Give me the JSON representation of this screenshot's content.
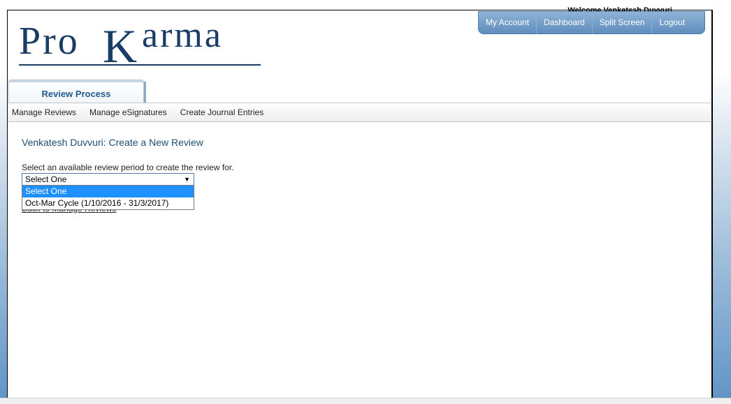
{
  "header": {
    "welcome": "Welcome Venkatesh Duvvuri",
    "logo_text": "ProKarma",
    "nav": [
      "My Account",
      "Dashboard",
      "Split Screen",
      "Logout"
    ]
  },
  "tabs": {
    "active": "Review Process"
  },
  "subnav": [
    "Manage Reviews",
    "Manage eSignatures",
    "Create Journal Entries"
  ],
  "main": {
    "heading": "Venkatesh Duvvuri: Create a New Review",
    "instruction": "Select an available review period to create the review for.",
    "select": {
      "value": "Select One",
      "options": [
        "Select One",
        "Oct-Mar Cycle (1/10/2016 - 31/3/2017)"
      ],
      "highlighted": "Select One"
    },
    "back_link": "Back to Manage Reviews"
  },
  "colors": {
    "brand": "#1a3d66",
    "nav_blue": "#6f9ac7",
    "highlight": "#1e90ff"
  }
}
